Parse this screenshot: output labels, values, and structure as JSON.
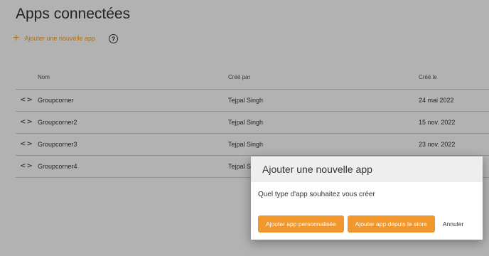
{
  "page": {
    "title": "Apps connectées",
    "add_app_label": "Ajouter une nouvelle app",
    "help_icon": "?"
  },
  "table": {
    "columns": [
      "Nom",
      "Créé par",
      "Créé le"
    ],
    "rows": [
      {
        "name": "Groupcorner",
        "creator": "Tejpal Singh",
        "date": "24 mai 2022"
      },
      {
        "name": "Groupcorner2",
        "creator": "Tejpal Singh",
        "date": "15 nov. 2022"
      },
      {
        "name": "Groupcorner3",
        "creator": "Tejpal Singh",
        "date": "23 nov. 2022"
      },
      {
        "name": "Groupcorner4",
        "creator": "Tejpal Singh",
        "date": ""
      }
    ],
    "row_icon": "<>"
  },
  "dialog": {
    "title": "Ajouter une nouvelle app",
    "question": "Quel type d'app souhaitez vous créer",
    "custom_button": "Ajouter app personnalisée",
    "store_button": "Ajouter app depuis le store",
    "cancel_button": "Annuler"
  },
  "colors": {
    "accent": "#f0982d",
    "overlay": "rgba(0,0,0,0.30)"
  }
}
